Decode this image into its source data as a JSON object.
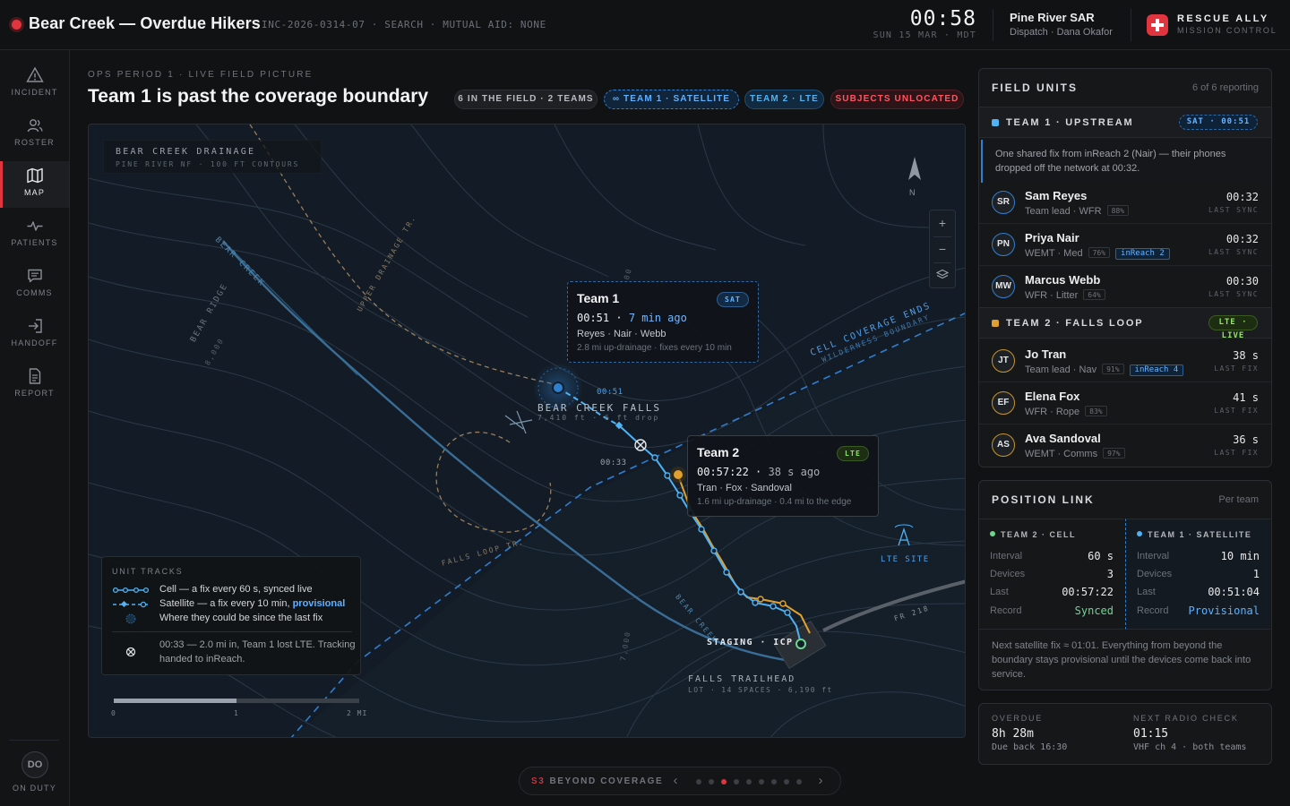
{
  "header": {
    "title": "Bear Creek — Overdue Hikers",
    "meta": "INC-2026-0314-07 · SEARCH · MUTUAL AID: NONE",
    "clock": "00:58",
    "date": "SUN 15 MAR · MDT",
    "org": "Pine River SAR",
    "dispatcher": "Dispatch · Dana Okafor",
    "brand": "RESCUE ALLY",
    "brand_sub": "MISSION CONTROL"
  },
  "rail": {
    "items": [
      {
        "label": "INCIDENT",
        "icon": "warning-triangle-icon"
      },
      {
        "label": "ROSTER",
        "icon": "people-icon"
      },
      {
        "label": "MAP",
        "icon": "map-icon"
      },
      {
        "label": "PATIENTS",
        "icon": "pulse-icon"
      },
      {
        "label": "COMMS",
        "icon": "chat-icon"
      },
      {
        "label": "HANDOFF",
        "icon": "handoff-arrow-icon"
      },
      {
        "label": "REPORT",
        "icon": "document-icon"
      }
    ],
    "active": "MAP",
    "user_initials": "DO",
    "user_status": "ON DUTY"
  },
  "main": {
    "eyebrow": "OPS PERIOD 1 · LIVE FIELD PICTURE",
    "title": "Team 1 is past the coverage boundary",
    "chips": {
      "field": "6 IN THE FIELD · 2 TEAMS",
      "team1": "TEAM 1 · SATELLITE",
      "team2": "TEAM 2 · LTE",
      "unlocated": "SUBJECTS UNLOCATED"
    }
  },
  "map": {
    "title": "BEAR CREEK DRAINAGE",
    "subtitle": "PINE RIVER NF · 100 FT CONTOURS",
    "north": "N",
    "zoom_in": "+",
    "zoom_out": "−",
    "labels": {
      "bear_creek_upper": "BEAR CREEK",
      "bear_ridge": "BEAR RIDGE",
      "bear_ridge_elev": "8,000",
      "upper_drainage": "UPPER DRAINAGE TR.",
      "contour_top": "00",
      "coverage_ends": "CELL COVERAGE ENDS",
      "wilderness": "WILDERNESS BOUNDARY",
      "falls_name": "BEAR CREEK FALLS",
      "falls_sub": "7,410 ft · 6 ft drop",
      "time_0051": "00:51",
      "time_0033": "00:33",
      "falls_loop": "FALLS LOOP TR.",
      "lte_site": "LTE SITE",
      "fr218": "FR 218",
      "bear_creek_lower": "BEAR CREEK",
      "contour_7000": "7,000",
      "staging": "STAGING · ICP",
      "trailhead": "FALLS TRAILHEAD",
      "trailhead_sub": "LOT · 14 SPACES · 6,190 ft"
    },
    "team1_callout": {
      "name": "Team 1",
      "badge": "SAT",
      "time": "00:51",
      "ago": "7 min ago",
      "members": "Reyes · Nair · Webb",
      "note": "2.8 mi up-drainage · fixes every 10 min"
    },
    "team2_callout": {
      "name": "Team 2",
      "badge": "LTE",
      "time": "00:57:22",
      "ago": "38 s ago",
      "members": "Tran · Fox · Sandoval",
      "note": "1.6 mi up-drainage · 0.4 mi to the edge"
    },
    "legend": {
      "title": "UNIT TRACKS",
      "cell": "Cell — a fix every 60 s, synced live",
      "satellite_prefix": "Satellite — a fix every 10 min,",
      "satellite_emph": "provisional",
      "uncertainty": "Where they could be since the last fix",
      "lost_note": "00:33 — 2.0 mi in, Team 1 lost LTE. Tracking handed to inReach."
    },
    "scale": [
      "0",
      "1",
      "2 MI"
    ]
  },
  "units": {
    "title": "FIELD UNITS",
    "reporting": "6 of 6 reporting",
    "team1": {
      "name": "TEAM 1 · UPSTREAM",
      "pill": "SAT · 00:51",
      "note": "One shared fix from inReach 2 (Nair) — their phones dropped off the network at 00:32.",
      "members": [
        {
          "initials": "SR",
          "name": "Sam Reyes",
          "role": "Team lead · WFR",
          "battery": "88%",
          "device": "",
          "time": "00:32",
          "time_label": "LAST SYNC"
        },
        {
          "initials": "PN",
          "name": "Priya Nair",
          "role": "WEMT · Med",
          "battery": "76%",
          "device": "inReach 2",
          "time": "00:32",
          "time_label": "LAST SYNC"
        },
        {
          "initials": "MW",
          "name": "Marcus Webb",
          "role": "WFR · Litter",
          "battery": "64%",
          "device": "",
          "time": "00:30",
          "time_label": "LAST SYNC"
        }
      ]
    },
    "team2": {
      "name": "TEAM 2 · FALLS LOOP",
      "pill": "LTE · LIVE",
      "members": [
        {
          "initials": "JT",
          "name": "Jo Tran",
          "role": "Team lead · Nav",
          "battery": "91%",
          "device": "inReach 4",
          "time": "38 s",
          "time_label": "LAST FIX"
        },
        {
          "initials": "EF",
          "name": "Elena Fox",
          "role": "WFR · Rope",
          "battery": "83%",
          "device": "",
          "time": "41 s",
          "time_label": "LAST FIX"
        },
        {
          "initials": "AS",
          "name": "Ava Sandoval",
          "role": "WEMT · Comms",
          "battery": "97%",
          "device": "",
          "time": "36 s",
          "time_label": "LAST FIX"
        }
      ]
    }
  },
  "link": {
    "title": "POSITION LINK",
    "right": "Per team",
    "team2": {
      "head": "TEAM 2 · CELL",
      "interval": "60 s",
      "devices": "3",
      "last": "00:57:22",
      "record": "Synced"
    },
    "team1": {
      "head": "TEAM 1 · SATELLITE",
      "interval": "10 min",
      "devices": "1",
      "last": "00:51:04",
      "record": "Provisional"
    },
    "keys": {
      "interval": "Interval",
      "devices": "Devices",
      "last": "Last",
      "record": "Record"
    },
    "note": "Next satellite fix ≈ 01:01. Everything from beyond the boundary stays provisional until the devices come back into service."
  },
  "status": {
    "overdue_label": "OVERDUE",
    "overdue_value": "8h 28m",
    "overdue_sub": "Due back 16:30",
    "radio_label": "NEXT RADIO CHECK",
    "radio_value": "01:15",
    "radio_sub": "VHF ch 4 · both teams"
  },
  "stepper": {
    "step": "S3",
    "label": "BEYOND COVERAGE",
    "total": 9,
    "current": 3
  },
  "colors": {
    "accent_red": "#e0343f",
    "cell_blue": "#4eb2f5",
    "sat_blue": "#2f7fd0",
    "team2_amber": "#e0a030",
    "synced_green": "#6fd690"
  }
}
